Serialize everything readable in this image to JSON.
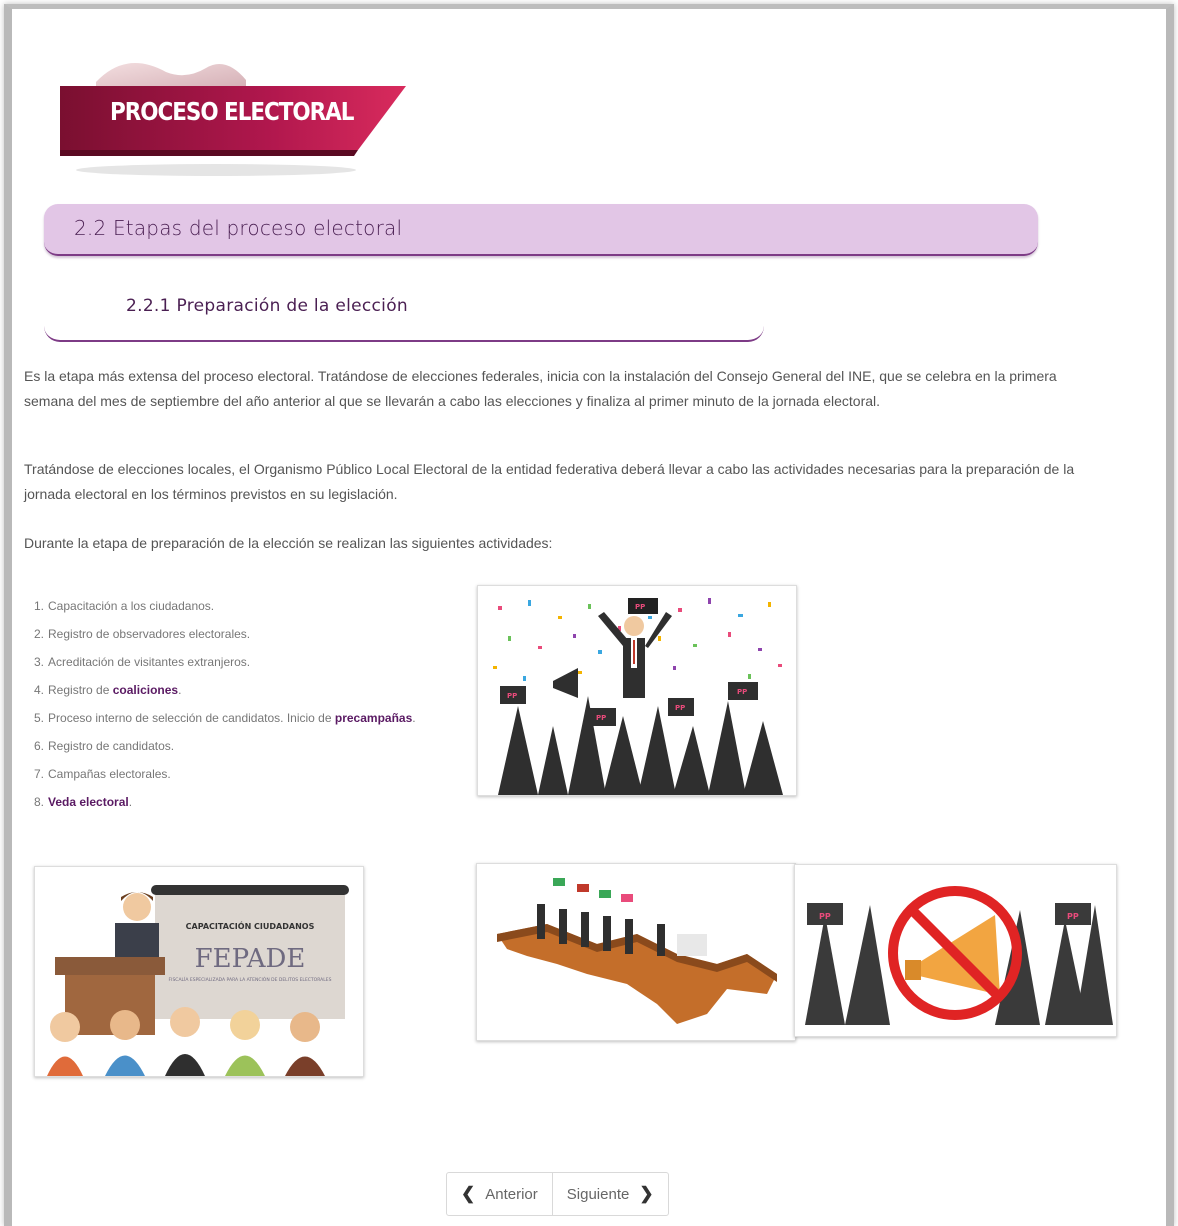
{
  "banner": {
    "title": "PROCESO ELECTORAL"
  },
  "section": {
    "title": "2.2 Etapas del proceso electoral"
  },
  "subsection": {
    "title": "2.2.1 Preparación de la elección"
  },
  "paragraphs": [
    "Es la etapa más extensa del proceso electoral. Tratándose de elecciones federales, inicia con la instalación del Consejo General del INE, que se celebra en la primera semana del mes de septiembre del año anterior al que se llevarán a cabo las elecciones y finaliza al primer minuto de la jornada electoral.",
    "Tratándose de elecciones locales, el Organismo Público Local Electoral de la entidad federativa deberá llevar a cabo las actividades necesarias para la preparación de la jornada electoral en los términos previstos en su legislación.",
    "Durante la etapa de preparación de la elección se realizan las siguientes actividades:"
  ],
  "activities": [
    {
      "num": "1.",
      "text": "Capacitación a los ciudadanos."
    },
    {
      "num": "2.",
      "text": "Registro de observadores electorales."
    },
    {
      "num": "3.",
      "text": "Acreditación de visitantes extranjeros."
    },
    {
      "num": "4.",
      "pre": "Registro de ",
      "link": "coaliciones",
      "post": "."
    },
    {
      "num": "5.",
      "pre": "Proceso interno de selección de candidatos. Inicio de ",
      "link": "precampañas",
      "post": "."
    },
    {
      "num": "6.",
      "text": "Registro de candidatos."
    },
    {
      "num": "7.",
      "text": "Campañas electorales."
    },
    {
      "num": "8.",
      "pre": "",
      "link": "Veda electoral",
      "post": "."
    }
  ],
  "images": {
    "fepade_header": "CAPACITACIÓN CIUDADANOS",
    "fepade_title": "FEPADE",
    "fepade_sub": "FISCALÍA ESPECIALIZADA PARA LA ATENCIÓN DE DELITOS ELECTORALES",
    "sign_text": "PP"
  },
  "nav": {
    "prev_label": "Anterior",
    "next_label": "Siguiente"
  },
  "colors": {
    "accent": "#5a1a63",
    "section_bg": "#e2c6e6",
    "banner": "#9b1744"
  }
}
